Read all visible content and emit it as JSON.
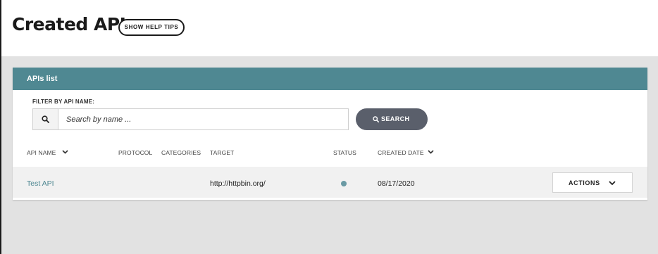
{
  "header": {
    "title": "Created APIs",
    "help_button": "SHOW HELP TIPS"
  },
  "panel": {
    "title": "APIs list",
    "filter": {
      "label": "FILTER BY API NAME:",
      "placeholder": "Search by name ...",
      "value": "",
      "search_button": "SEARCH"
    },
    "columns": {
      "api_name": "API NAME",
      "protocol": "PROTOCOL",
      "categories": "CATEGORIES",
      "target": "TARGET",
      "status": "STATUS",
      "created_date": "CREATED DATE"
    },
    "rows": [
      {
        "api_name": "Test API",
        "protocol": "",
        "categories": "",
        "target": "http://httpbin.org/",
        "status_color": "#6a9aa4",
        "created_date": "08/17/2020",
        "actions_label": "ACTIONS"
      }
    ]
  },
  "colors": {
    "panel_header": "#4f8892",
    "search_button": "#5a5f6b",
    "content_background": "#e2e2e2"
  }
}
